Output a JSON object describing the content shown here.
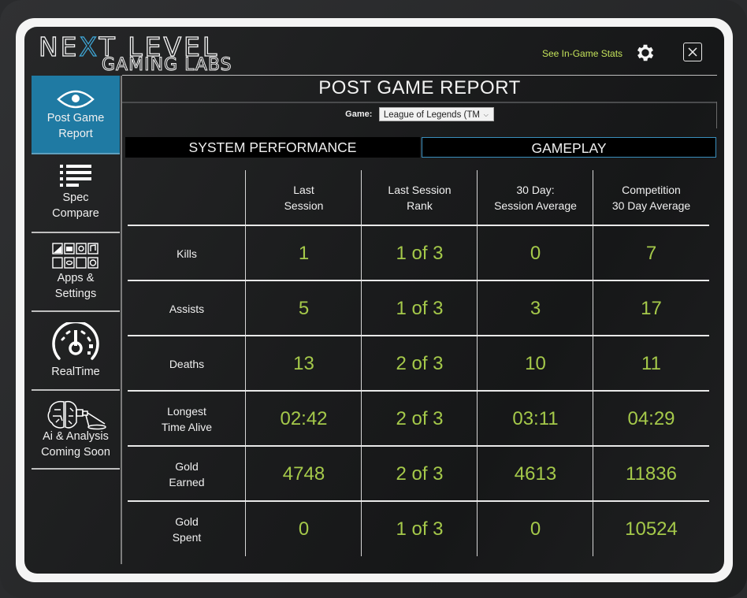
{
  "brand": {
    "line1_pre": "NE",
    "line1_x": "X",
    "line1_post": "T LEVEL",
    "line2": "GAMING LABS",
    "accent_color": "#3ea3d1"
  },
  "header": {
    "see_stats_link": "See In-Game Stats",
    "settings_icon": "gear-icon",
    "close_icon": "close-icon"
  },
  "sidebar": {
    "items": [
      {
        "label_lines": [
          "Post Game",
          "Report"
        ],
        "icon": "eye-icon",
        "active": true
      },
      {
        "label_lines": [
          "Spec",
          "Compare"
        ],
        "icon": "list-icon",
        "active": false
      },
      {
        "label_lines": [
          "Apps &",
          "Settings"
        ],
        "icon": "apps-grid-icon",
        "active": false
      },
      {
        "label_lines": [
          "RealTime"
        ],
        "icon": "speedometer-icon",
        "active": false
      },
      {
        "label_lines": [
          "Ai & Analysis",
          "Coming Soon"
        ],
        "icon": "brain-projector-icon",
        "active": false
      }
    ],
    "active_color": "#1f7aa3"
  },
  "main": {
    "title": "POST GAME REPORT",
    "game_label": "Game:",
    "game_selected": "League of Legends (TM",
    "tabs": [
      {
        "label": "SYSTEM PERFORMANCE",
        "active": false
      },
      {
        "label": "GAMEPLAY",
        "active": true
      }
    ]
  },
  "table": {
    "columns": [
      [
        "Last",
        "Session"
      ],
      [
        "Last Session",
        "Rank"
      ],
      [
        "30 Day:",
        "Session Average"
      ],
      [
        "Competition",
        "30 Day Average"
      ]
    ],
    "rows": [
      {
        "label": [
          "Kills"
        ],
        "values": [
          "1",
          "1 of 3",
          "0",
          "7"
        ]
      },
      {
        "label": [
          "Assists"
        ],
        "values": [
          "5",
          "1 of 3",
          "3",
          "17"
        ]
      },
      {
        "label": [
          "Deaths"
        ],
        "values": [
          "13",
          "2 of 3",
          "10",
          "11"
        ]
      },
      {
        "label": [
          "Longest",
          "Time Alive"
        ],
        "values": [
          "02:42",
          "2 of 3",
          "03:11",
          "04:29"
        ]
      },
      {
        "label": [
          "Gold",
          "Earned"
        ],
        "values": [
          "4748",
          "2 of 3",
          "4613",
          "11836"
        ]
      },
      {
        "label": [
          "Gold",
          "Spent"
        ],
        "values": [
          "0",
          "1 of 3",
          "0",
          "10524"
        ]
      }
    ],
    "value_color": "#a5c94a"
  }
}
